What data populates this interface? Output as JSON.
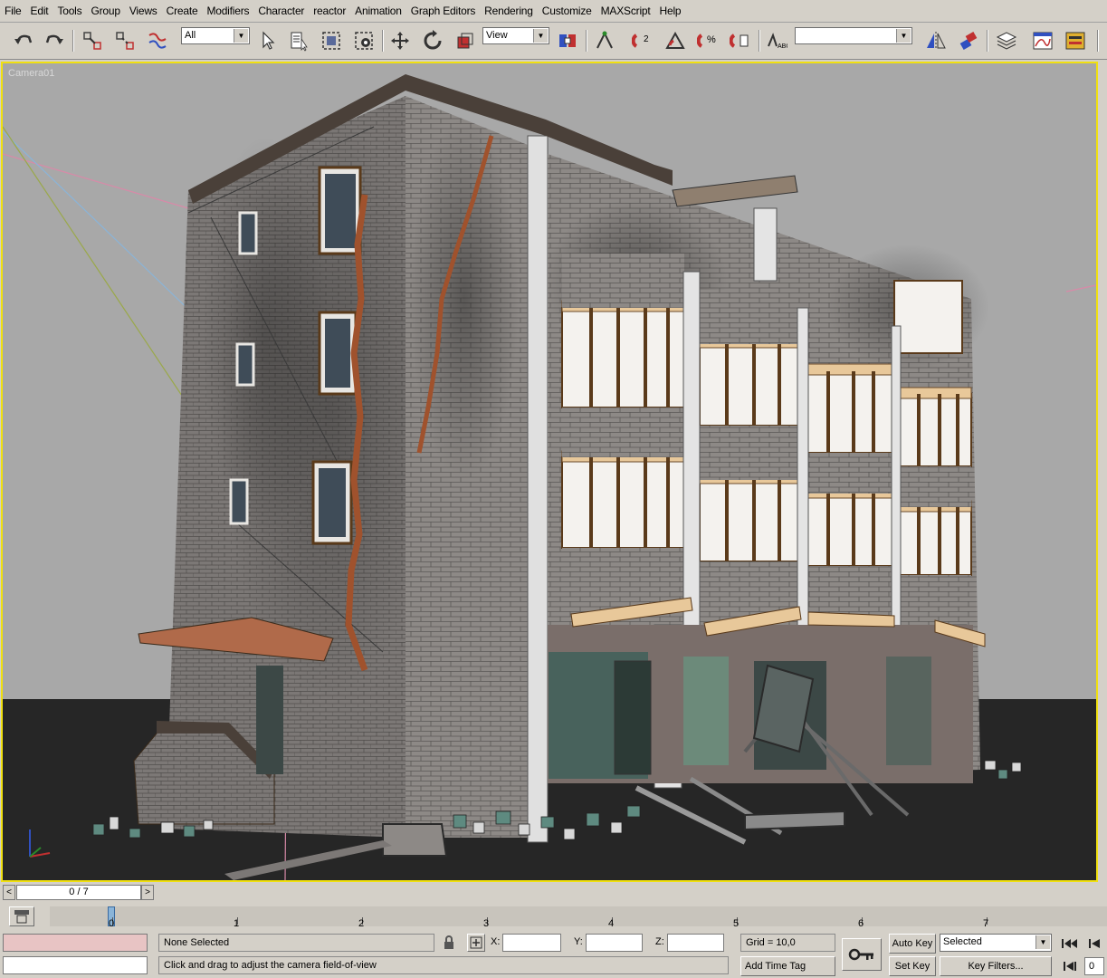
{
  "menubar": {
    "items": [
      "File",
      "Edit",
      "Tools",
      "Group",
      "Views",
      "Create",
      "Modifiers",
      "Character",
      "reactor",
      "Animation",
      "Graph Editors",
      "Rendering",
      "Customize",
      "MAXScript",
      "Help"
    ]
  },
  "toolbar": {
    "selection_filter": "All",
    "reference_coord": "View",
    "named_selection": "",
    "icons": [
      "undo-icon",
      "redo-icon",
      "select-and-link-icon",
      "unlink-icon",
      "bind-space-warp-icon",
      "select-object-icon",
      "select-by-name-icon",
      "rectangular-selection-icon",
      "window-crossing-icon",
      "move-icon",
      "rotate-icon",
      "scale-icon",
      "use-pivot-center-icon",
      "select-and-manipulate-icon",
      "snaps-toggle-icon",
      "angle-snap-icon",
      "percent-snap-icon",
      "spinner-snap-icon",
      "edit-named-selections-icon",
      "mirror-icon",
      "align-icon",
      "layer-manager-icon",
      "curve-editor-icon",
      "schematic-view-icon"
    ]
  },
  "viewport": {
    "label": "Camera01",
    "border_color": "#f0e010",
    "background": "#a8a8a8",
    "ground": "#262626"
  },
  "timeslider": {
    "frame": "0 / 7",
    "left_arrow": "<",
    "right_arrow": ">"
  },
  "trackbar": {
    "ticks": [
      "0",
      "1",
      "2",
      "3",
      "4",
      "5",
      "6",
      "7"
    ]
  },
  "status": {
    "selection": "None Selected",
    "prompt": "Click and drag to adjust the camera field-of-view",
    "x_label": "X:",
    "y_label": "Y:",
    "z_label": "Z:",
    "x_value": "",
    "y_value": "",
    "z_value": "",
    "grid": "Grid = 10,0",
    "add_time_tag": "Add Time Tag",
    "auto_key": "Auto Key",
    "set_key": "Set Key",
    "key_mode": "Selected",
    "key_filters": "Key Filters...",
    "frame_field": "0"
  }
}
